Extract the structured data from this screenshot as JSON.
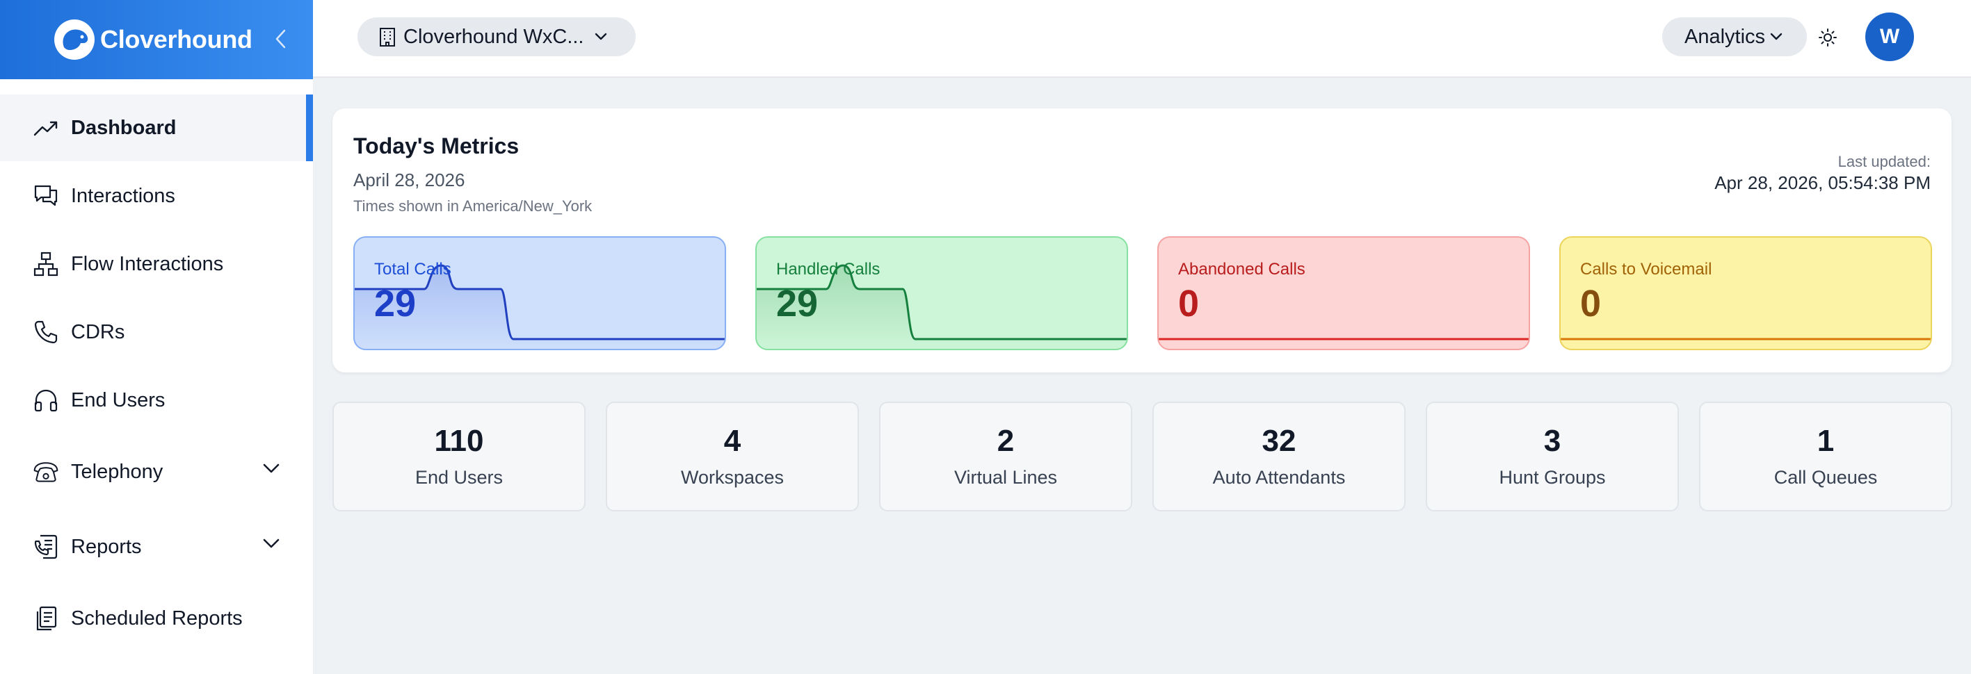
{
  "brand": {
    "name": "Cloverhound"
  },
  "sidebar": {
    "items": [
      {
        "label": "Dashboard",
        "icon": "trend-up-icon",
        "active": true
      },
      {
        "label": "Interactions",
        "icon": "chat-bubbles-icon"
      },
      {
        "label": "Flow Interactions",
        "icon": "flow-tree-icon"
      },
      {
        "label": "CDRs",
        "icon": "phone-icon"
      },
      {
        "label": "End Users",
        "icon": "headphones-icon"
      },
      {
        "label": "Telephony",
        "icon": "telephone-icon",
        "expandable": true
      },
      {
        "label": "Reports",
        "icon": "phone-report-icon",
        "expandable": true
      },
      {
        "label": "Scheduled Reports",
        "icon": "clipboard-list-icon"
      }
    ]
  },
  "topbar": {
    "org_selector": "Cloverhound WxC...",
    "analytics_label": "Analytics",
    "avatar_initial": "W"
  },
  "metrics": {
    "title": "Today's Metrics",
    "date": "April 28, 2026",
    "timezone": "Times shown in America/New_York",
    "last_updated_label": "Last updated:",
    "last_updated_value": "Apr 28, 2026, 05:54:38 PM",
    "tiles": [
      {
        "label": "Total Calls",
        "value": "29",
        "color": "#1d4ed8"
      },
      {
        "label": "Handled Calls",
        "value": "29",
        "color": "#15803d"
      },
      {
        "label": "Abandoned Calls",
        "value": "0",
        "color": "#b91c1c"
      },
      {
        "label": "Calls to Voicemail",
        "value": "0",
        "color": "#a16207"
      }
    ]
  },
  "stats": [
    {
      "value": "110",
      "label": "End Users"
    },
    {
      "value": "4",
      "label": "Workspaces"
    },
    {
      "value": "2",
      "label": "Virtual Lines"
    },
    {
      "value": "32",
      "label": "Auto Attendants"
    },
    {
      "value": "3",
      "label": "Hunt Groups"
    },
    {
      "value": "1",
      "label": "Call Queues"
    }
  ],
  "colors": {
    "brand": "#1e6fd9",
    "accent": "#2b7ce9",
    "avatar": "#1962c9"
  }
}
